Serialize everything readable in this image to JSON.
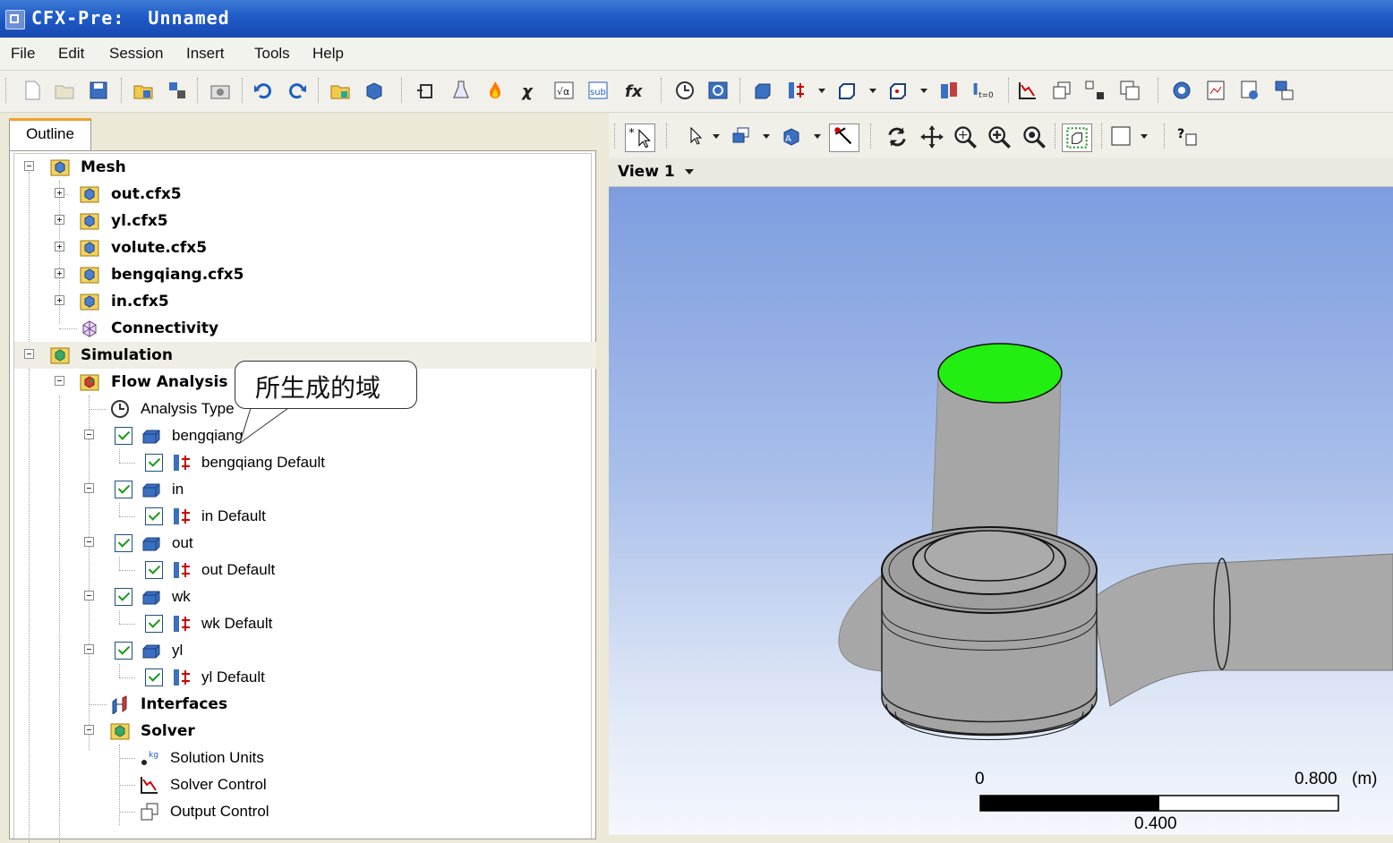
{
  "window": {
    "title": "CFX-Pre:  Unnamed"
  },
  "menu": [
    "File",
    "Edit",
    "Session",
    "Insert",
    "Tools",
    "Help"
  ],
  "outline": {
    "tab_label": "Outline",
    "mesh": {
      "label": "Mesh",
      "files": [
        "out.cfx5",
        "yl.cfx5",
        "volute.cfx5",
        "bengqiang.cfx5",
        "in.cfx5"
      ],
      "connectivity": "Connectivity"
    },
    "simulation": {
      "label": "Simulation",
      "flow_analysis": "Flow Analysis 1",
      "analysis_type": "Analysis Type",
      "domains": [
        {
          "name": "bengqiang",
          "default": "bengqiang Default"
        },
        {
          "name": "in",
          "default": "in Default"
        },
        {
          "name": "out",
          "default": "out Default"
        },
        {
          "name": "wk",
          "default": "wk Default"
        },
        {
          "name": "yl",
          "default": "yl Default"
        }
      ],
      "interfaces": "Interfaces",
      "solver": {
        "label": "Solver",
        "children": [
          "Solution Units",
          "Solver Control",
          "Output Control"
        ]
      }
    }
  },
  "callout": {
    "text": "所生成的域"
  },
  "viewer": {
    "view_label": "View 1",
    "scale": {
      "min": "0",
      "mid": "0.400",
      "max": "0.800",
      "unit": "(m)"
    }
  },
  "colors": {
    "inlet_highlight": "#22ee11",
    "titlebar": "#1f5bc8"
  }
}
